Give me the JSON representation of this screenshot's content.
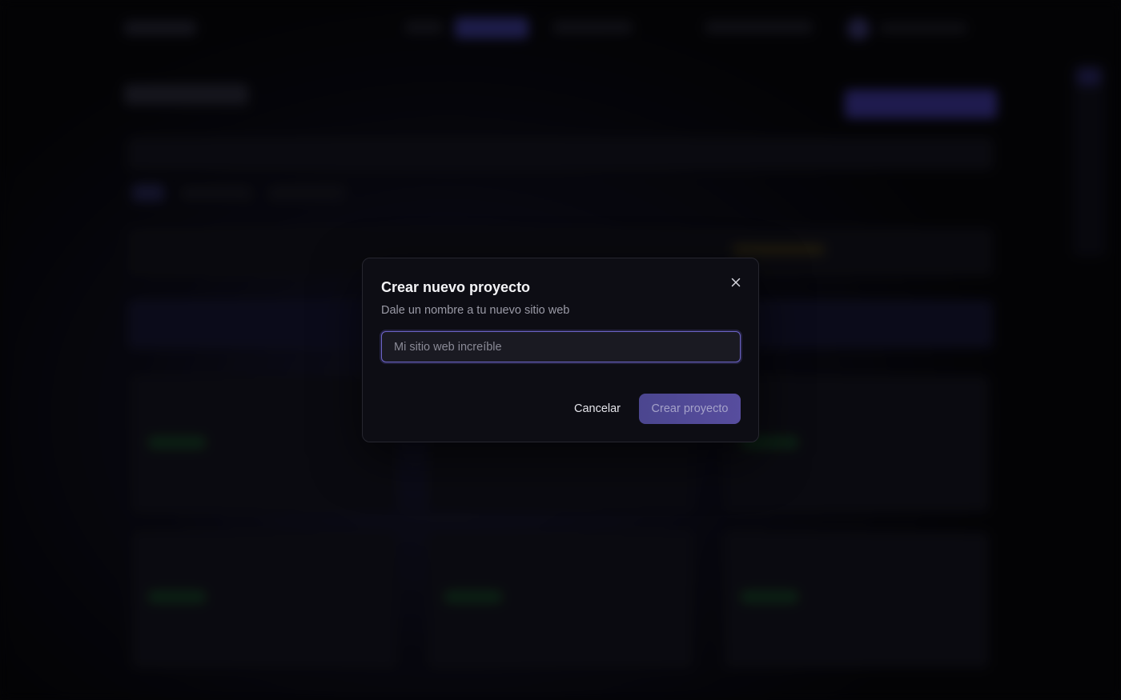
{
  "dialog": {
    "title": "Crear nuevo proyecto",
    "description": "Dale un nombre a tu nuevo sitio web",
    "input_placeholder": "Mi sitio web increíble",
    "input_value": "",
    "cancel_label": "Cancelar",
    "create_label": "Crear proyecto",
    "close_icon": "close-icon"
  },
  "colors": {
    "accent": "#6d64c8",
    "primary_button": "#574d9e",
    "dialog_bg": "#0d0d14",
    "backdrop": "#060609"
  }
}
